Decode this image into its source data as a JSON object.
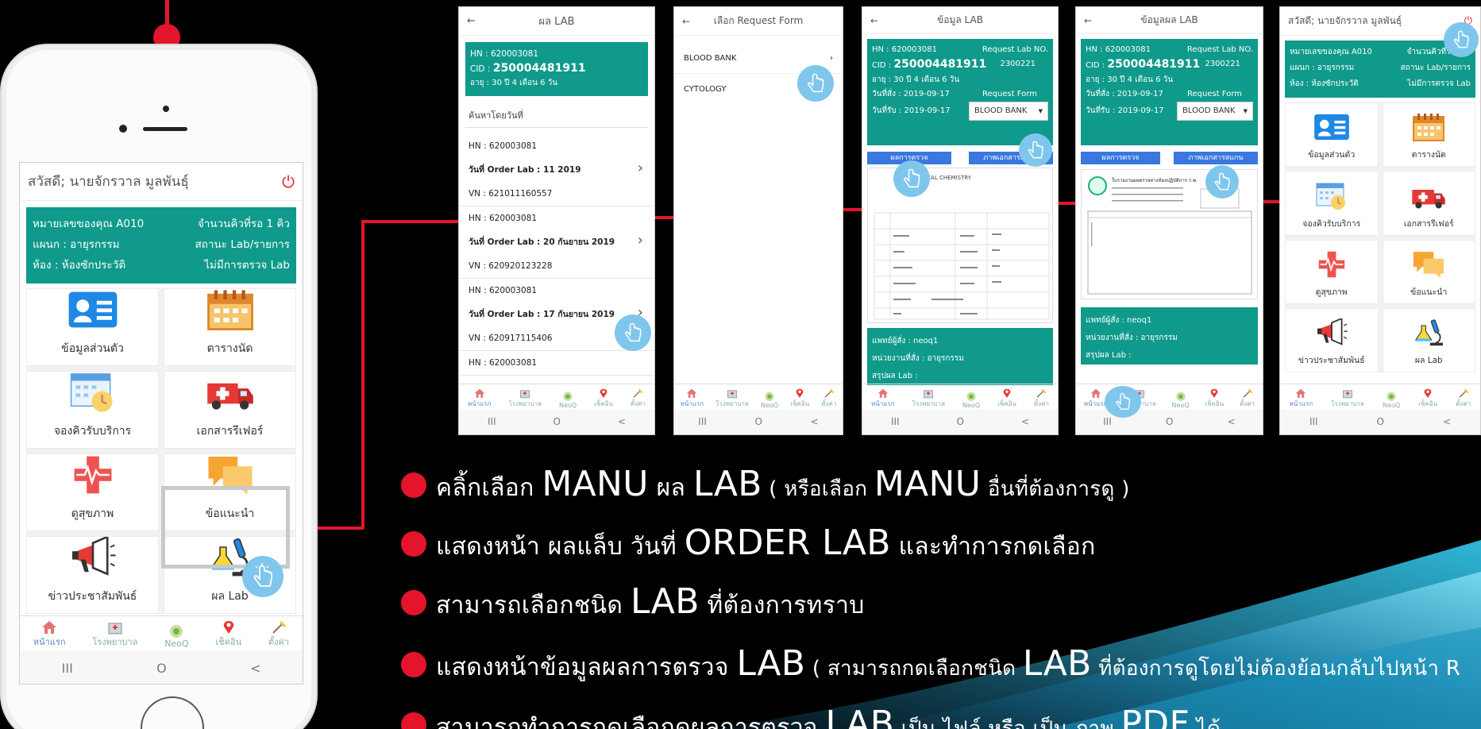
{
  "colors": {
    "teal": "#0f9a8b",
    "red": "#e4152b",
    "blue": "#3a78e0",
    "hand": "#7fc6ec"
  },
  "home": {
    "greeting": "สวัสดี; นายจักรวาล มูลพันธุ์",
    "power_icon": "power-icon",
    "info": {
      "queue": "หมายเลขของคุณ A010",
      "waiting": "จำนวนคิวที่รอ 1 คิว",
      "dept": "แผนก : อายุรกรรม",
      "status": "สถานะ Lab/รายการ",
      "room": "ห้อง : ห้องซักประวัติ",
      "lab": "ไม่มีการตรวจ Lab"
    },
    "tiles": [
      {
        "label": "ข้อมูลส่วนตัว",
        "icon": "id-card-icon"
      },
      {
        "label": "ตารางนัด",
        "icon": "calendar-icon"
      },
      {
        "label": "จองคิวรับบริการ",
        "icon": "calendar-clock-icon"
      },
      {
        "label": "เอกสารรีเฟอร์",
        "icon": "ambulance-icon"
      },
      {
        "label": "ดูสุขภาพ",
        "icon": "health-cross-icon"
      },
      {
        "label": "ข้อแนะนำ",
        "icon": "chat-bubbles-icon"
      },
      {
        "label": "ข่าวประชาสัมพันธ์",
        "icon": "megaphone-icon"
      },
      {
        "label": "ผล Lab",
        "icon": "microscope-icon"
      }
    ],
    "nav": [
      {
        "label": "หน้าแรก",
        "icon": "home-icon"
      },
      {
        "label": "โรงพยาบาล",
        "icon": "hospital-icon"
      },
      {
        "label": "NeoQ",
        "icon": "neoq-icon"
      },
      {
        "label": "เช็คอิน",
        "icon": "location-pin-icon"
      },
      {
        "label": "ตั้งค่า",
        "icon": "settings-icon"
      }
    ],
    "sys": [
      "III",
      "O",
      "<"
    ]
  },
  "lab_list": {
    "back": "←",
    "title": "ผล LAB",
    "hn": "HN : 620003081",
    "cid_label": "CID :",
    "cid": "250004481911",
    "age": "อายุ : 30 ปี 4 เดือน 6 วัน",
    "search": "ค้นหาโดยวันที่",
    "entries": [
      {
        "hn": "HN : 620003081",
        "date": "วันที่ Order Lab : 11 2019",
        "vn": "VN : 621011160557"
      },
      {
        "hn": "HN : 620003081",
        "date": "วันที่ Order Lab : 20 กันยายน 2019",
        "vn": "VN : 620920123228"
      },
      {
        "hn": "HN : 620003081",
        "date": "วันที่ Order Lab : 17 กันยายน 2019",
        "vn": "VN : 620917115406"
      },
      {
        "hn": "HN : 620003081",
        "date": "",
        "vn": ""
      }
    ]
  },
  "request_form": {
    "back": "←",
    "title": "เลือก Request Form",
    "items": [
      "BLOOD BANK",
      "CYTOLOGY"
    ]
  },
  "lab_detail": {
    "back": "←",
    "title": "ข้อมูล LAB",
    "hn": "HN : 620003081",
    "req_no_label": "Request Lab NO.",
    "cid_label": "CID :",
    "cid": "250004481911",
    "req_no": "2300221",
    "age": "อายุ : 30 ปี 4 เดือน 6 วัน",
    "order_date": "วันที่สั่ง : 2019-09-17",
    "form_label": "Request Form",
    "receive_date": "วันที่รับ : 2019-09-17",
    "form_value": "BLOOD BANK",
    "tab1": "ผลการตรวจ",
    "tab2": "ภาพเอกสารสแกน",
    "doc_title": "CLINICAL CHEMISTRY",
    "doctor": "แพทย์ผู้สั่ง : neoq1",
    "unit": "หน่วยงานที่สั่ง : อายุรกรรม",
    "summary": "สรุปผล Lab :"
  },
  "lab_result": {
    "back": "←",
    "title": "ข้อมูลผล LAB",
    "hn": "HN : 620003081",
    "req_no_label": "Request Lab NO.",
    "cid_label": "CID :",
    "cid": "250004481911",
    "req_no": "2300221",
    "age": "อายุ : 30 ปี 4 เดือน 6 วัน",
    "order_date": "วันที่สั่ง : 2019-09-17",
    "form_label": "Request Form",
    "receive_date": "วันที่รับ : 2019-09-17",
    "form_value": "BLOOD BANK",
    "tab1": "ผลการตรวจ",
    "tab2": "ภาพเอกสารสแกน",
    "doc_header": "ใบรายงานผลตรวจทางห้องปฏิบัติการ ร.พ.",
    "doctor": "แพทย์ผู้สั่ง : neoq1",
    "unit": "หน่วยงานที่สั่ง : อายุรกรรม",
    "summary": "สรุปผล Lab :"
  },
  "home_small": {
    "greeting": "สวัสดี; นายจักรวาล มูลพันธุ์",
    "info": {
      "queue": "หมายเลขของคุณ A010",
      "waiting": "จำนวนคิวที่รอ 1 คิ",
      "dept": "แผนก : อายุรกรรม",
      "status": "สถานะ Lab/รายการ",
      "room": "ห้อง : ห้องซักประวัติ",
      "lab": "ไม่มีการตรวจ Lab"
    },
    "tiles": [
      "ข้อมูลส่วนตัว",
      "ตารางนัด",
      "จองคิวรับบริการ",
      "เอกสารรีเฟอร์",
      "ดูสุขภาพ",
      "ข้อแนะนำ",
      "ข่าวประชาสัมพันธ์",
      "ผล Lab"
    ],
    "nav": [
      "หน้าแรก",
      "โรงพยาบาล",
      "NeoQ",
      "เช็คอิน",
      "ตั้งค่า"
    ]
  },
  "bullets": [
    {
      "pre": "คลิ้กเลือก ",
      "b1": "MANU",
      "mid": " ผล ",
      "b2": "LAB",
      "post": " ( หรือเลือก ",
      "b3": "MANU",
      "end": " อื่นที่ต้องการดู )"
    },
    {
      "pre": "แสดงหน้า ผลแล็บ วันที่ ",
      "b1": "ORDER  LAB",
      "post": " และทำการกดเลือก"
    },
    {
      "pre": "สามารถเลือกชนิด ",
      "b1": "LAB",
      "post": " ที่ต้องการทราบ"
    },
    {
      "pre": "แสดงหน้าข้อมูลผลการตรวจ ",
      "b1": "LAB",
      "post": " ( สามารถกดเลือกชนิด ",
      "b2": "LAB",
      "end": " ที่ต้องการดูโดยไม่ต้องย้อนกลับไปหน้า R"
    },
    {
      "pre": "สามารถทำการกดเลือกดูผลการตรวจ ",
      "b1": "LAB",
      "post": " เป็น ไฟล์ หรือ เป็น ภาพ ",
      "b2": "PDF",
      "end": " ได้"
    }
  ]
}
